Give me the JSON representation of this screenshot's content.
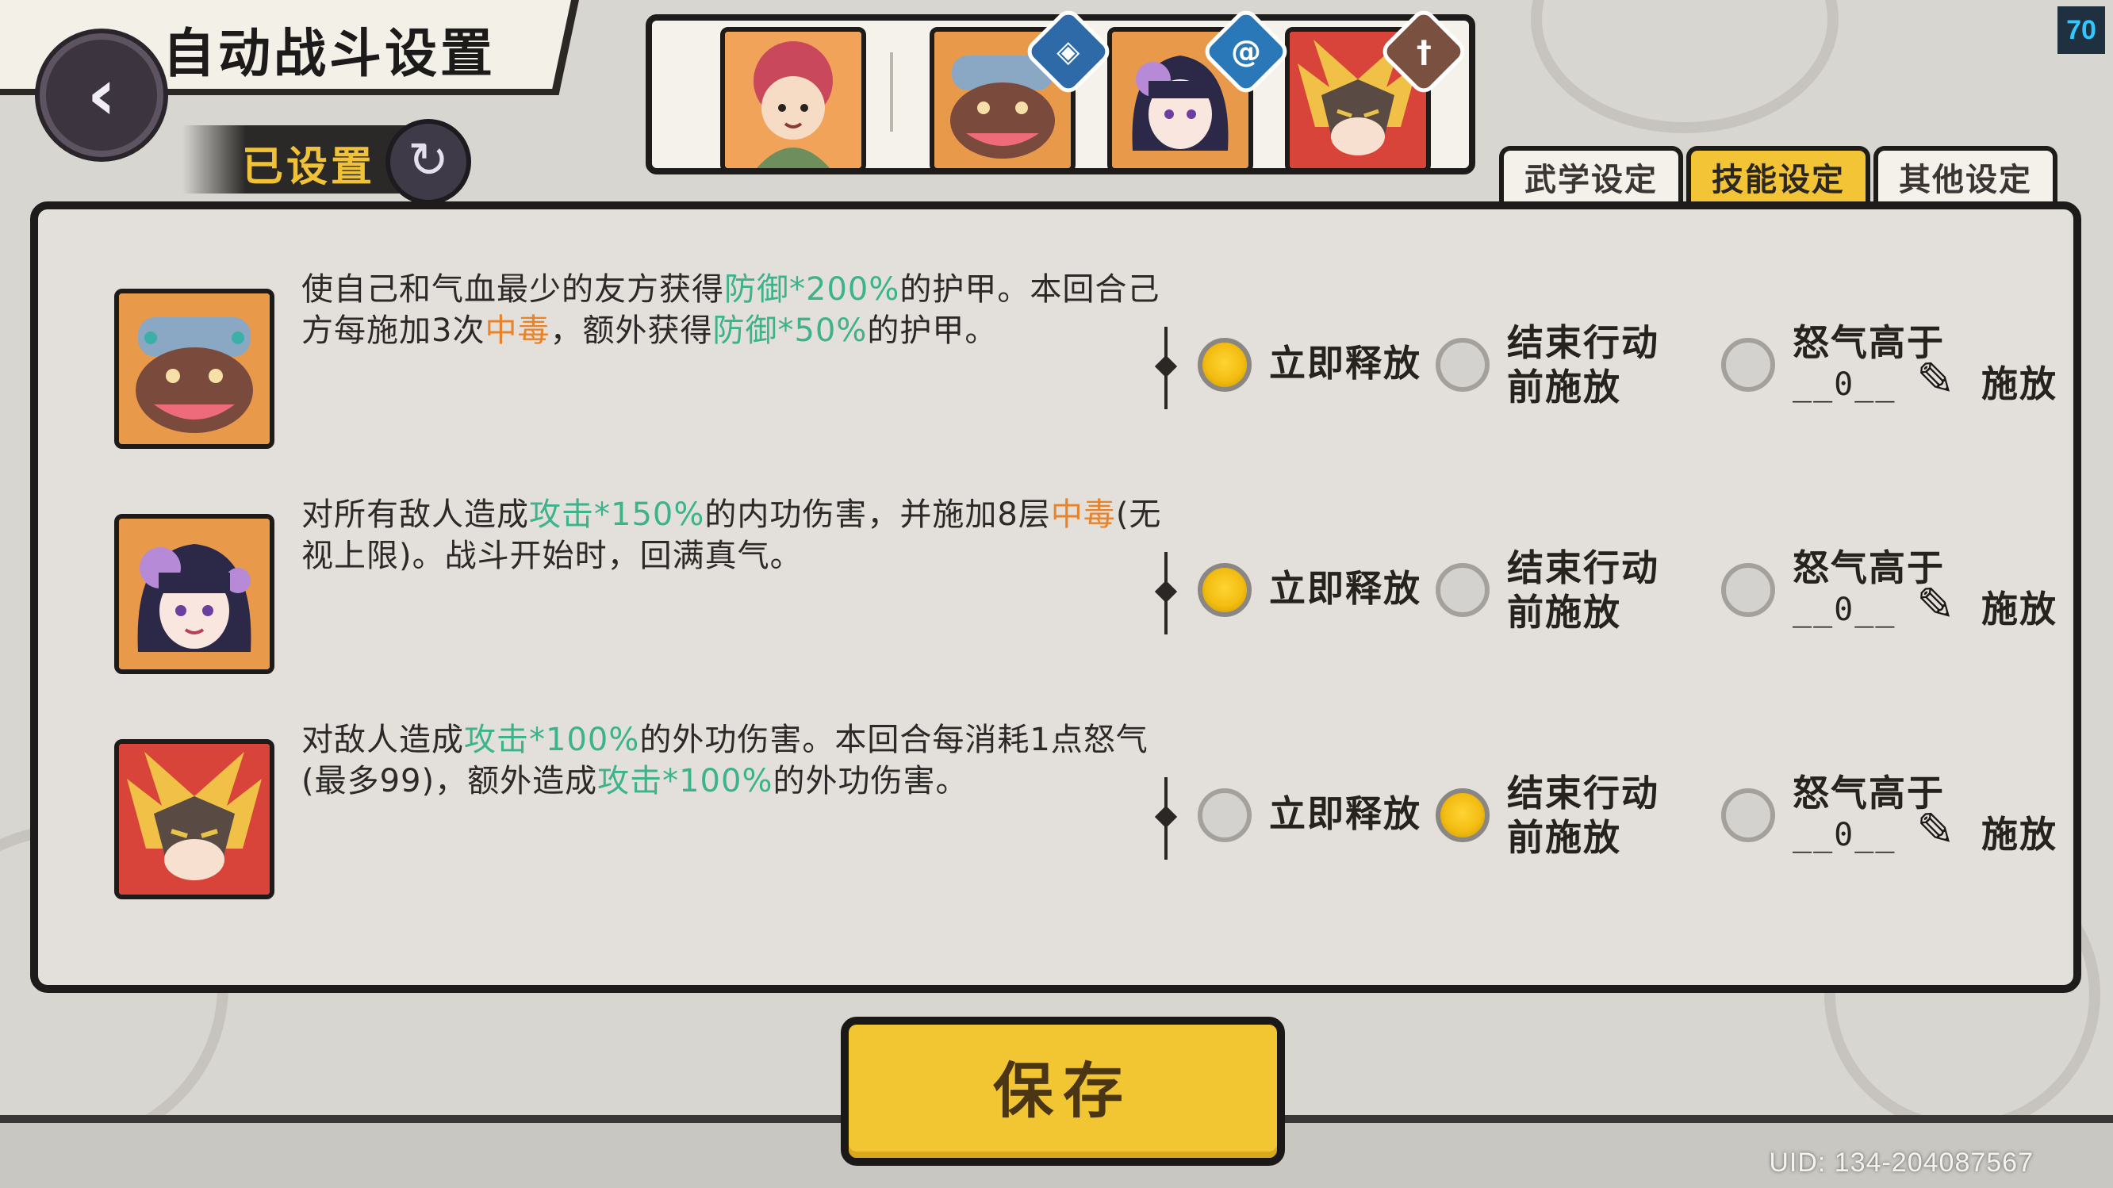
{
  "header": {
    "title": "自动战斗设置",
    "status_badge": "已设置",
    "level": "70"
  },
  "team": [
    {
      "name": "hero-red-hair",
      "tag_icon": ""
    },
    {
      "name": "hero-toad",
      "tag_icon": "shield-icon"
    },
    {
      "name": "hero-purple",
      "tag_icon": "swirl-icon"
    },
    {
      "name": "hero-dragon-mask",
      "tag_icon": "sword-icon"
    }
  ],
  "tabs": [
    {
      "label": "武学设定",
      "active": false
    },
    {
      "label": "技能设定",
      "active": true
    },
    {
      "label": "其他设定",
      "active": false
    }
  ],
  "skills": [
    {
      "desc_parts": [
        {
          "t": "使自己和气血最少的友方获得",
          "c": ""
        },
        {
          "t": "防御*200%",
          "c": "g"
        },
        {
          "t": "的护甲。本回合己方每施加3次",
          "c": ""
        },
        {
          "t": "中毒",
          "c": "o"
        },
        {
          "t": "，额外获得",
          "c": ""
        },
        {
          "t": "防御*50%",
          "c": "g"
        },
        {
          "t": "的护甲。",
          "c": ""
        }
      ],
      "selected": 0,
      "threshold": "__0__"
    },
    {
      "desc_parts": [
        {
          "t": "对所有敌人造成",
          "c": ""
        },
        {
          "t": "攻击*150%",
          "c": "g"
        },
        {
          "t": "的内功伤害，并施加8层",
          "c": ""
        },
        {
          "t": "中毒",
          "c": "o"
        },
        {
          "t": "(无视上限)。战斗开始时，回满真气。",
          "c": ""
        }
      ],
      "selected": 0,
      "threshold": "__0__"
    },
    {
      "desc_parts": [
        {
          "t": "对敌人造成",
          "c": ""
        },
        {
          "t": "攻击*100%",
          "c": "g"
        },
        {
          "t": "的外功伤害。本回合每消耗1点怒气(最多99)，额外造成",
          "c": ""
        },
        {
          "t": "攻击*100%",
          "c": "g"
        },
        {
          "t": "的外功伤害。",
          "c": ""
        }
      ],
      "selected": 1,
      "threshold": "__0__"
    }
  ],
  "options": {
    "immediate": "立即释放",
    "before_end_line1": "结束行动",
    "before_end_line2": "前施放",
    "rage_line1": "怒气高于",
    "rage_suffix": "施放"
  },
  "save_label": "保存",
  "uid": "UID: 134-204087567",
  "colors": {
    "accent_yellow": "#f2c633",
    "highlight_green": "#3db38c",
    "highlight_orange": "#e8832a",
    "panel_bg": "#e3dfda"
  }
}
